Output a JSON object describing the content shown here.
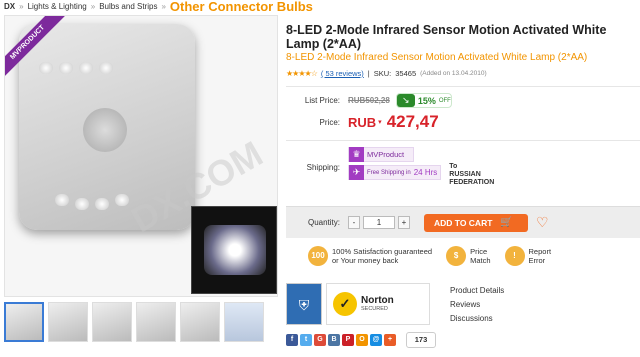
{
  "breadcrumb": {
    "root": "DX",
    "sep": "»",
    "items": [
      "Lights & Lighting",
      "Bulbs and Strips"
    ],
    "current": "Other Connector Bulbs"
  },
  "product": {
    "title": "8-LED 2-Mode Infrared Sensor Motion Activated White Lamp (2*AA)",
    "subtitle": "8-LED 2-Mode Infrared Sensor Motion Activated White Lamp (2*AA)",
    "rating": 4.5,
    "stars": "★★★★☆",
    "reviews_text": "( 53 reviews)",
    "sku_label": "SKU:",
    "sku": "35465",
    "added": "(Added on 13.04.2010)",
    "ribbon": "MVPRODUCT",
    "watermark": "DX.COM"
  },
  "pricing": {
    "list_label": "List Price:",
    "list_price": "RUB502,28",
    "discount": "15%",
    "discount_off": "OFF",
    "discount_icon": "down-arrow-icon",
    "price_label": "Price:",
    "currency": "RUB",
    "currency_dd": "▾",
    "price": "427,47"
  },
  "shipping": {
    "label": "Shipping:",
    "mvproduct": "MVProduct",
    "free_text": "Free Shipping in",
    "hours": "24 Hrs",
    "to_text": "To",
    "country_line1": "RUSSIAN",
    "country_line2": "FEDERATION"
  },
  "cart": {
    "qty_label": "Quantity:",
    "minus": "-",
    "qty": "1",
    "plus": "+",
    "add_label": "ADD TO CART"
  },
  "guarantees": [
    {
      "icon": "100",
      "text1": "100% Satisfaction guaranteed",
      "text2": "or Your money back"
    },
    {
      "icon": "$",
      "text1": "Price",
      "text2": "Match"
    },
    {
      "icon": "!",
      "text1": "Report",
      "text2": "Error"
    }
  ],
  "norton": {
    "name": "Norton",
    "sub": "SECURED"
  },
  "links": [
    "Product Details",
    "Reviews",
    "Discussions"
  ],
  "social": {
    "buttons": [
      {
        "letter": "f",
        "color": "#3b5998"
      },
      {
        "letter": "t",
        "color": "#55acee"
      },
      {
        "letter": "G",
        "color": "#dd4b39"
      },
      {
        "letter": "В",
        "color": "#4c75a3"
      },
      {
        "letter": "P",
        "color": "#cb2027"
      },
      {
        "letter": "О",
        "color": "#f29400"
      },
      {
        "letter": "@",
        "color": "#168de2"
      },
      {
        "letter": "+",
        "color": "#e95c27"
      }
    ],
    "count": "173"
  },
  "colors": {
    "accent": "#f29400",
    "price": "#d8232a",
    "cart": "#f26a22",
    "mvp": "#a23bc2",
    "link": "#1a5fb4",
    "discount": "#2b8a2b"
  }
}
